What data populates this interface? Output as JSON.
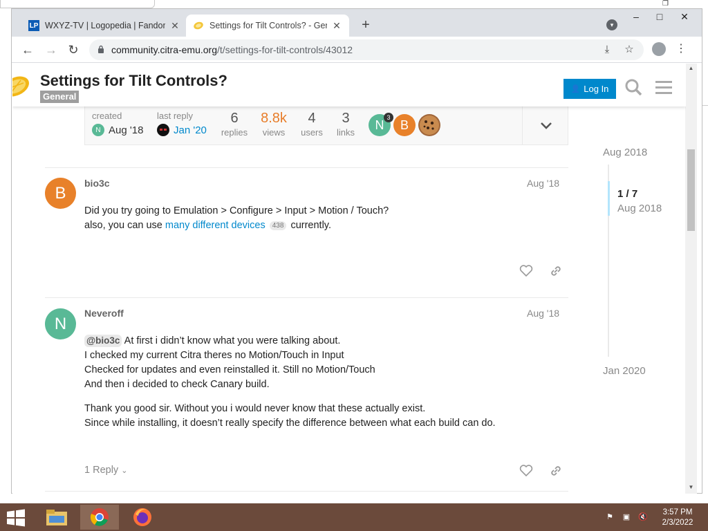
{
  "browser": {
    "tabs": [
      {
        "favicon_text": "LP",
        "title": "WXYZ-TV | Logopedia | Fandom",
        "active": false
      },
      {
        "favicon_text": "",
        "title": "Settings for Tilt Controls? - Gene",
        "active": true
      }
    ],
    "url_domain": "community.citra-emu.org",
    "url_path": "/t/settings-for-tilt-controls/43012"
  },
  "header": {
    "title": "Settings for Tilt Controls?",
    "category": "General",
    "login_label": "Log In"
  },
  "topic_map": {
    "created_label": "created",
    "created_date": "Aug '18",
    "created_avatar_letter": "N",
    "last_reply_label": "last reply",
    "last_reply_date": "Jan '20",
    "stats": [
      {
        "num": "6",
        "label": "replies"
      },
      {
        "num": "8.8k",
        "label": "views"
      },
      {
        "num": "4",
        "label": "users"
      },
      {
        "num": "3",
        "label": "links"
      }
    ],
    "participants": [
      {
        "letter": "N",
        "count": "3"
      },
      {
        "letter": "B",
        "count": ""
      }
    ]
  },
  "posts": [
    {
      "avatar_letter": "B",
      "username": "bio3c",
      "date": "Aug '18",
      "line1": "Did you try going to Emulation > Configure > Input > Motion / Touch?",
      "line2_pre": "also, you can use ",
      "line2_link": "many different devices",
      "line2_clicks": "438",
      "line2_post": " currently."
    },
    {
      "avatar_letter": "N",
      "username": "Neveroff",
      "date": "Aug '18",
      "mention": "@bio3c",
      "p1_line1": " At first i didn’t know what you were talking about.",
      "p1_line2": "I checked my current Citra theres no Motion/Touch in Input",
      "p1_line3": "Checked for updates and even reinstalled it. Still no Motion/Touch",
      "p1_line4": "And then i decided to check Canary build.",
      "p2_line1": "Thank you good sir. Without you i would never know that these actually exist.",
      "p2_line2": "Since while installing, it doesn’t really specify the difference between what each build can do.",
      "reply_label": "1 Reply"
    }
  ],
  "timeline": {
    "top": "Aug 2018",
    "position": "1 / 7",
    "position_date": "Aug 2018",
    "bottom": "Jan 2020"
  },
  "taskbar": {
    "time": "3:57 PM",
    "date": "2/3/2022"
  },
  "colors": {
    "accent": "#0088cc",
    "views_orange": "#e87d29",
    "avatar_b": "#e8812a",
    "avatar_n": "#59b996",
    "taskbar": "#6b4a3b"
  }
}
